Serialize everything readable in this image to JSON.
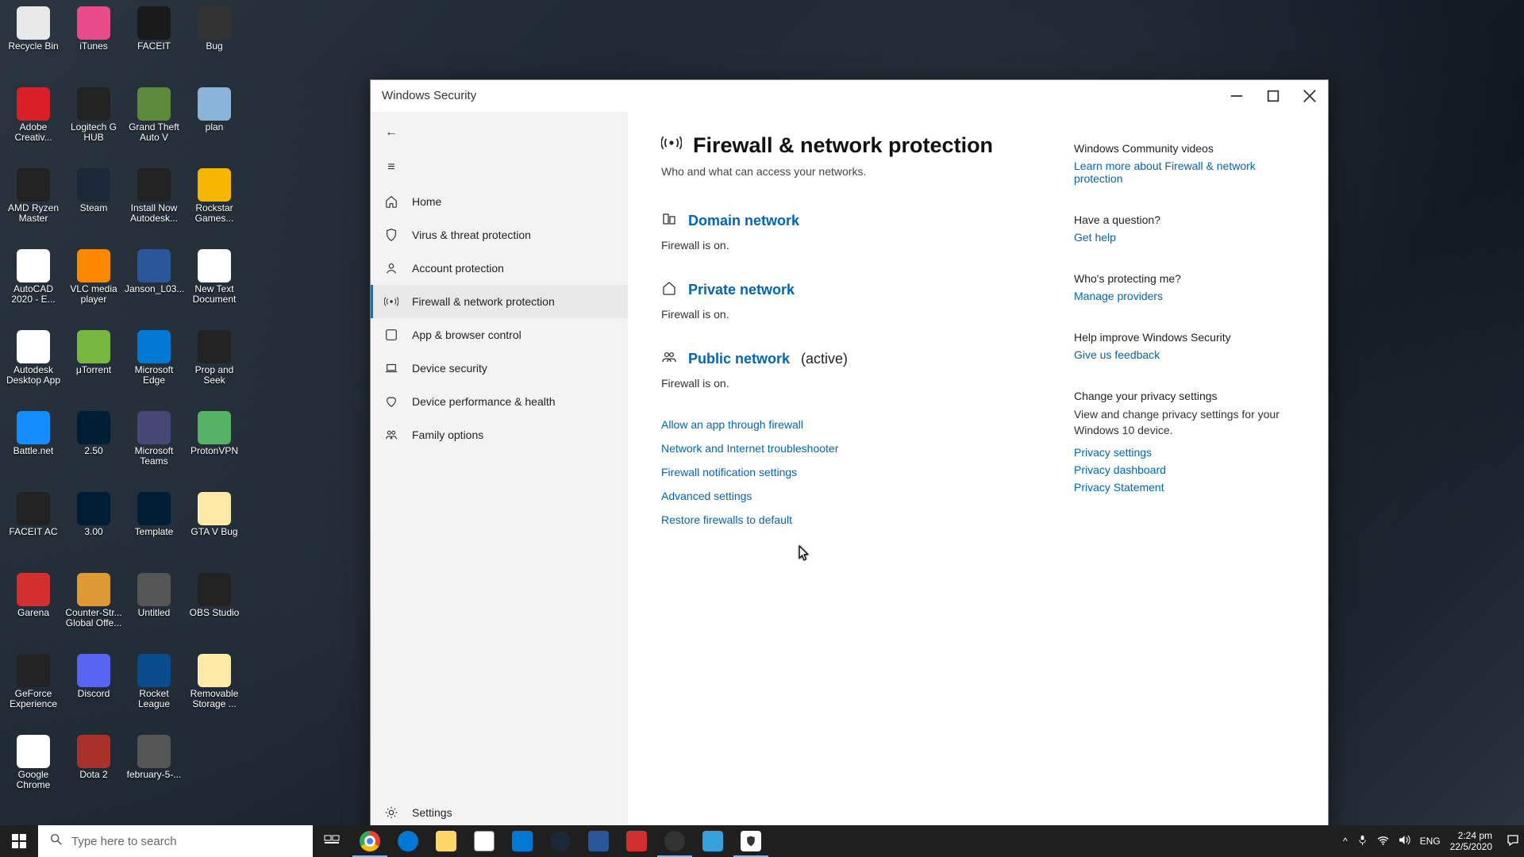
{
  "window": {
    "title": "Windows Security"
  },
  "nav": {
    "home": "Home",
    "virus": "Virus & threat protection",
    "account": "Account protection",
    "firewall": "Firewall & network protection",
    "app": "App & browser control",
    "device": "Device security",
    "perf": "Device performance & health",
    "family": "Family options",
    "settings": "Settings"
  },
  "page": {
    "title": "Firewall & network protection",
    "subtitle": "Who and what can access your networks.",
    "networks": [
      {
        "icon": "domain",
        "name": "Domain network",
        "suffix": "",
        "status": "Firewall is on."
      },
      {
        "icon": "private",
        "name": "Private network",
        "suffix": "",
        "status": "Firewall is on."
      },
      {
        "icon": "public",
        "name": "Public network",
        "suffix": "  (active)",
        "status": "Firewall is on."
      }
    ],
    "actions": [
      "Allow an app through firewall",
      "Network and Internet troubleshooter",
      "Firewall notification settings",
      "Advanced settings",
      "Restore firewalls to default"
    ]
  },
  "sidepanel": {
    "videos_h": "Windows Community videos",
    "videos_l": "Learn more about Firewall & network protection",
    "question_h": "Have a question?",
    "question_l": "Get help",
    "protect_h": "Who's protecting me?",
    "protect_l": "Manage providers",
    "improve_h": "Help improve Windows Security",
    "improve_l": "Give us feedback",
    "privacy_h": "Change your privacy settings",
    "privacy_t": "View and change privacy settings for your Windows 10 device.",
    "privacy_l1": "Privacy settings",
    "privacy_l2": "Privacy dashboard",
    "privacy_l3": "Privacy Statement"
  },
  "desktop": [
    {
      "l": "Recycle Bin",
      "c": "#e8e8e8"
    },
    {
      "l": "iTunes",
      "c": "#ea4c89"
    },
    {
      "l": "FACEIT",
      "c": "#1a1a1a"
    },
    {
      "l": "Bug",
      "c": "#333"
    },
    {
      "l": "Adobe Creativ...",
      "c": "#da1f26"
    },
    {
      "l": "Logitech G HUB",
      "c": "#222"
    },
    {
      "l": "Grand Theft Auto V",
      "c": "#5a8a3a"
    },
    {
      "l": "plan",
      "c": "#8ab4d8"
    },
    {
      "l": "AMD Ryzen Master",
      "c": "#222"
    },
    {
      "l": "Steam",
      "c": "#1b2838"
    },
    {
      "l": "Install Now Autodesk...",
      "c": "#222"
    },
    {
      "l": "Rockstar Games...",
      "c": "#f7b500"
    },
    {
      "l": "AutoCAD 2020 - E...",
      "c": "#fff"
    },
    {
      "l": "VLC media player",
      "c": "#ff8800"
    },
    {
      "l": "Janson_L03...",
      "c": "#2b579a"
    },
    {
      "l": "New Text Document",
      "c": "#fff"
    },
    {
      "l": "Autodesk Desktop App",
      "c": "#fff"
    },
    {
      "l": "μTorrent",
      "c": "#76b83f"
    },
    {
      "l": "Microsoft Edge",
      "c": "#0078d4"
    },
    {
      "l": "Prop and Seek",
      "c": "#222"
    },
    {
      "l": "Battle.net",
      "c": "#148eff"
    },
    {
      "l": "2.50",
      "c": "#001e36"
    },
    {
      "l": "Microsoft Teams",
      "c": "#464775"
    },
    {
      "l": "ProtonVPN",
      "c": "#56b366"
    },
    {
      "l": "FACEIT AC",
      "c": "#222"
    },
    {
      "l": "3.00",
      "c": "#001e36"
    },
    {
      "l": "Template",
      "c": "#001e36"
    },
    {
      "l": "GTA V Bug",
      "c": "#ffe9a6"
    },
    {
      "l": "Garena",
      "c": "#d32f2f"
    },
    {
      "l": "Counter-Str... Global Offe...",
      "c": "#de9b35"
    },
    {
      "l": "Untitled",
      "c": "#555"
    },
    {
      "l": "OBS Studio",
      "c": "#222"
    },
    {
      "l": "GeForce Experience",
      "c": "#222"
    },
    {
      "l": "Discord",
      "c": "#5865f2"
    },
    {
      "l": "Rocket League",
      "c": "#0a4d8c"
    },
    {
      "l": "Removable Storage ...",
      "c": "#ffe9a6"
    },
    {
      "l": "Google Chrome",
      "c": "#fff"
    },
    {
      "l": "Dota 2",
      "c": "#a8322a"
    },
    {
      "l": "february-5-...",
      "c": "#555"
    }
  ],
  "taskbar": {
    "search_placeholder": "Type here to search",
    "lang": "ENG",
    "time": "2:24 pm",
    "date": "22/5/2020"
  }
}
